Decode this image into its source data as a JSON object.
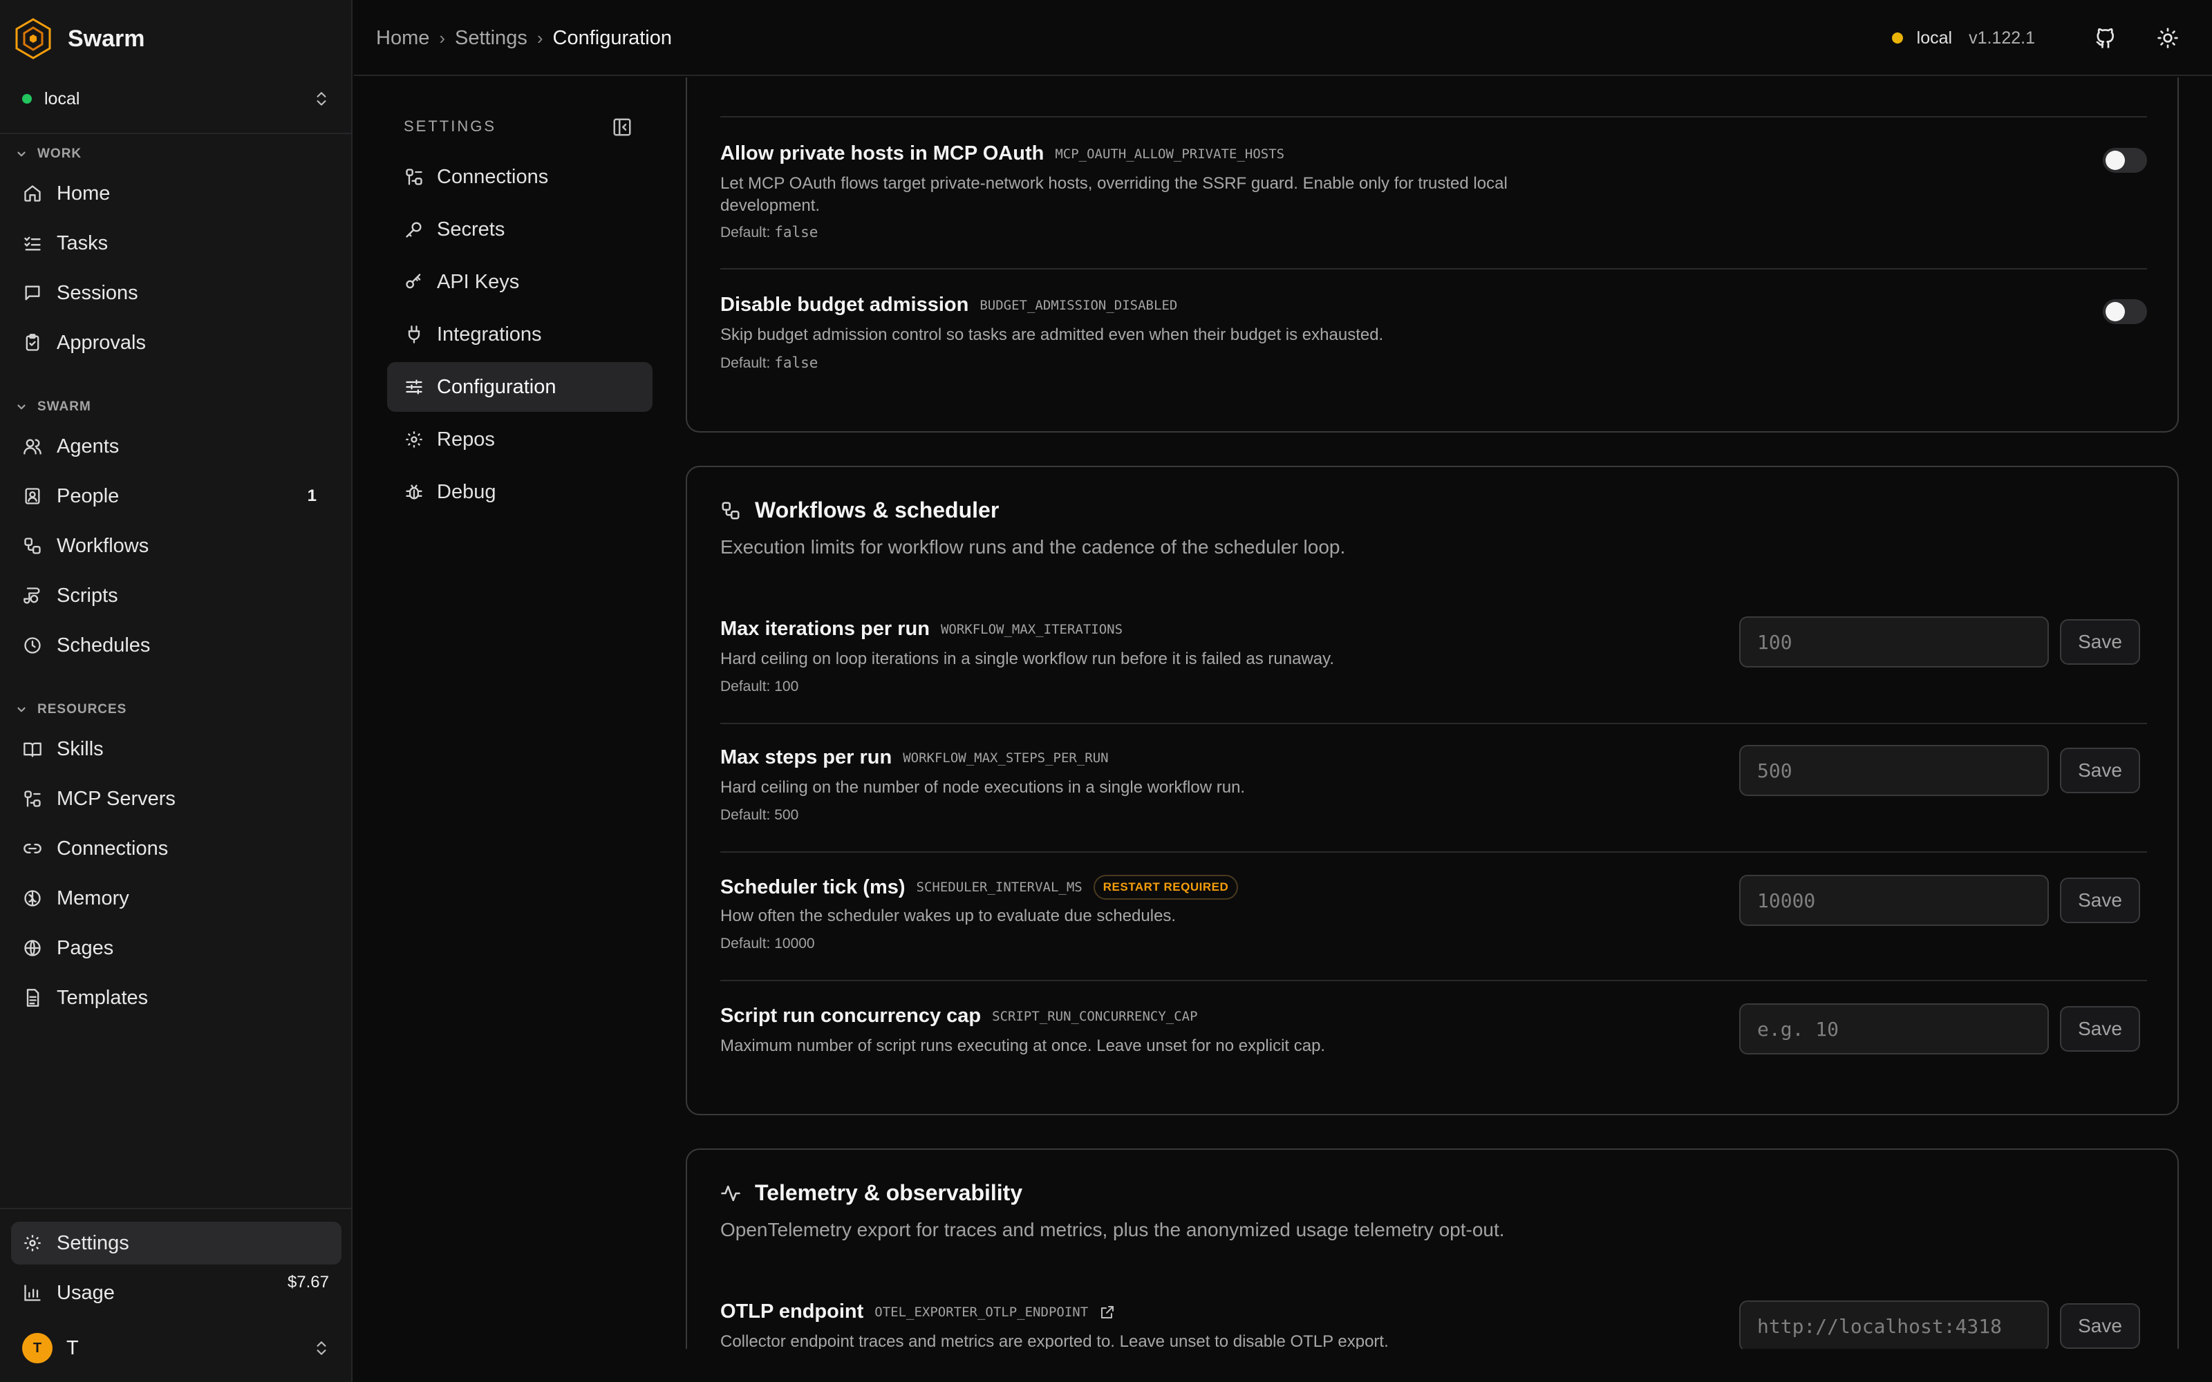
{
  "app": {
    "name": "Swarm"
  },
  "workspace": {
    "name": "local"
  },
  "sidebar": {
    "sections": [
      {
        "title": "WORK",
        "items": [
          {
            "label": "Home",
            "icon": "home-icon"
          },
          {
            "label": "Tasks",
            "icon": "list-checks-icon"
          },
          {
            "label": "Sessions",
            "icon": "message-icon"
          },
          {
            "label": "Approvals",
            "icon": "clipboard-check-icon"
          }
        ]
      },
      {
        "title": "SWARM",
        "items": [
          {
            "label": "Agents",
            "icon": "users-icon"
          },
          {
            "label": "People",
            "icon": "contact-icon",
            "badge": "1"
          },
          {
            "label": "Workflows",
            "icon": "workflow-icon"
          },
          {
            "label": "Scripts",
            "icon": "script-icon"
          },
          {
            "label": "Schedules",
            "icon": "clock-icon"
          }
        ]
      },
      {
        "title": "RESOURCES",
        "items": [
          {
            "label": "Skills",
            "icon": "book-icon"
          },
          {
            "label": "MCP Servers",
            "icon": "server-icon"
          },
          {
            "label": "Connections",
            "icon": "link-icon"
          },
          {
            "label": "Memory",
            "icon": "brain-icon"
          },
          {
            "label": "Pages",
            "icon": "globe-icon"
          },
          {
            "label": "Templates",
            "icon": "file-icon"
          }
        ]
      }
    ],
    "footer": {
      "settings": "Settings",
      "usage": "Usage",
      "usage_amount": "$7.67",
      "user_initial": "T",
      "user_name": "T"
    }
  },
  "header": {
    "breadcrumb": [
      "Home",
      "Settings",
      "Configuration"
    ],
    "env": {
      "name": "local",
      "version": "v1.122.1",
      "status_color": "#eab308"
    }
  },
  "settings_nav": {
    "heading": "SETTINGS",
    "items": [
      {
        "label": "Connections",
        "icon": "connections-icon"
      },
      {
        "label": "Secrets",
        "icon": "key-icon"
      },
      {
        "label": "API Keys",
        "icon": "api-key-icon"
      },
      {
        "label": "Integrations",
        "icon": "plug-icon"
      },
      {
        "label": "Configuration",
        "icon": "sliders-icon",
        "active": true
      },
      {
        "label": "Repos",
        "icon": "gear-icon"
      },
      {
        "label": "Debug",
        "icon": "bug-icon"
      }
    ]
  },
  "cards": {
    "security_partial": {
      "rows": [
        {
          "title": "Allow private hosts in MCP OAuth",
          "env": "MCP_OAUTH_ALLOW_PRIVATE_HOSTS",
          "help_line1": "Let MCP OAuth flows target private-network hosts, overriding the SSRF guard. Enable only for trusted local",
          "help_line2": "development.",
          "default_label": "Default: ",
          "default_value": "false",
          "enabled": false
        },
        {
          "title": "Disable budget admission",
          "env": "BUDGET_ADMISSION_DISABLED",
          "help": "Skip budget admission control so tasks are admitted even when their budget is exhausted.",
          "default_label": "Default: ",
          "default_value": "false",
          "enabled": false
        }
      ]
    },
    "workflows": {
      "title": "Workflows & scheduler",
      "description": "Execution limits for workflow runs and the cadence of the scheduler loop.",
      "rows": [
        {
          "title": "Max iterations per run",
          "env": "WORKFLOW_MAX_ITERATIONS",
          "help": "Hard ceiling on loop iterations in a single workflow run before it is failed as runaway.",
          "default": "Default: 100",
          "placeholder": "100",
          "save": "Save"
        },
        {
          "title": "Max steps per run",
          "env": "WORKFLOW_MAX_STEPS_PER_RUN",
          "help": "Hard ceiling on the number of node executions in a single workflow run.",
          "default": "Default: 500",
          "placeholder": "500",
          "save": "Save"
        },
        {
          "title": "Scheduler tick (ms)",
          "env": "SCHEDULER_INTERVAL_MS",
          "badge": "RESTART REQUIRED",
          "help": "How often the scheduler wakes up to evaluate due schedules.",
          "default": "Default: 10000",
          "placeholder": "10000",
          "save": "Save"
        },
        {
          "title": "Script run concurrency cap",
          "env": "SCRIPT_RUN_CONCURRENCY_CAP",
          "help": "Maximum number of script runs executing at once. Leave unset for no explicit cap.",
          "placeholder": "e.g. 10",
          "save": "Save"
        }
      ]
    },
    "telemetry": {
      "title": "Telemetry & observability",
      "description": "OpenTelemetry export for traces and metrics, plus the anonymized usage telemetry opt-out.",
      "rows": [
        {
          "title": "OTLP endpoint",
          "env": "OTEL_EXPORTER_OTLP_ENDPOINT",
          "help": "Collector endpoint traces and metrics are exported to. Leave unset to disable OTLP export.",
          "placeholder": "http://localhost:4318",
          "save": "Save"
        }
      ]
    }
  },
  "colors": {
    "accent_gold": "#f59e0b",
    "status_green": "#22c55e",
    "background": "#0b0b0c"
  }
}
